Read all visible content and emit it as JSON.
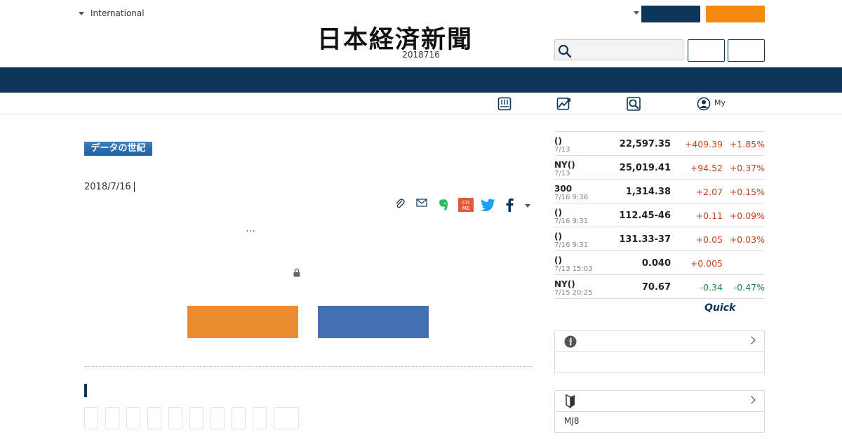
{
  "header": {
    "region_label": "International",
    "logo_text": "日本経済新聞",
    "date": "2018716",
    "search": {
      "placeholder": ""
    }
  },
  "subnav": {
    "my_label": "My"
  },
  "article": {
    "badge": "データの世紀",
    "date": "2018/7/16",
    "ellipsis": "…"
  },
  "colors": {
    "navy": "#0d3557",
    "orange_header_button": "#f5890f",
    "cta_orange": "#ec8b2f",
    "cta_blue": "#436fb3",
    "up": "#c8421d",
    "down": "#1a8a3a"
  },
  "market": {
    "rows": [
      {
        "name": "()",
        "time": "7/13",
        "value": "22,597.35",
        "change": "+409.39",
        "pct": "+1.85%",
        "dir": "up"
      },
      {
        "name": "NY()",
        "time": "7/13",
        "value": "25,019.41",
        "change": "+94.52",
        "pct": "+0.37%",
        "dir": "up"
      },
      {
        "name": "300",
        "time": "7/16 9:36",
        "value": "1,314.38",
        "change": "+2.07",
        "pct": "+0.15%",
        "dir": "up"
      },
      {
        "name": "()",
        "time": "7/16 9:31",
        "value": "112.45-46",
        "change": "+0.11",
        "pct": "+0.09%",
        "dir": "up"
      },
      {
        "name": "()",
        "time": "7/16 9:31",
        "value": "131.33-37",
        "change": "+0.05",
        "pct": "+0.03%",
        "dir": "up"
      },
      {
        "name": "()",
        "time": "7/13 15:03",
        "value": "0.040",
        "change": "+0.005",
        "pct": "",
        "dir": "up"
      },
      {
        "name": "NY()",
        "time": "7/15 20:25",
        "value": "70.67",
        "change": "-0.34",
        "pct": "-0.47%",
        "dir": "down"
      }
    ],
    "provider": "Quick"
  },
  "panel2": {
    "text": "MJ8"
  },
  "icons": [
    "search-icon",
    "newspaper-icon",
    "chart-icon",
    "magnifier-icon",
    "user-icon",
    "clip-icon",
    "mail-icon",
    "evernote-icon",
    "comemo-icon",
    "twitter-icon",
    "facebook-icon",
    "lock-icon",
    "info-icon",
    "beginner-mark-icon"
  ]
}
